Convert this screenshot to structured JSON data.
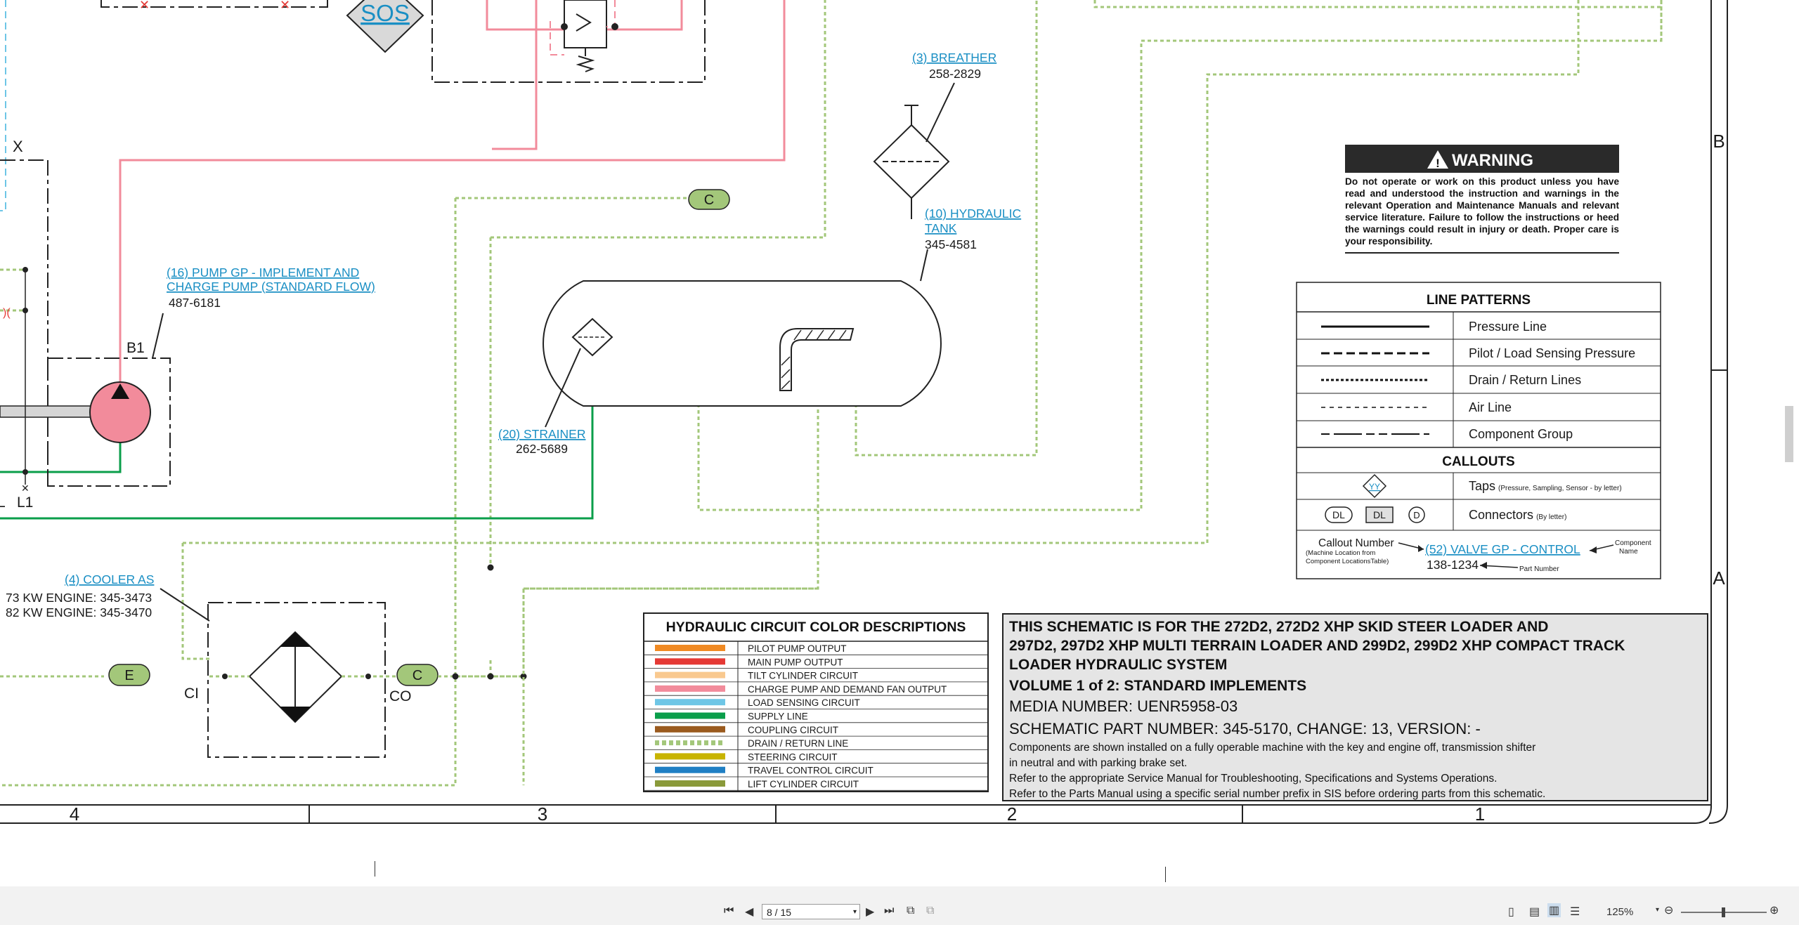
{
  "diagram": {
    "sos_label": "SOS",
    "port_labels": {
      "x": "X",
      "b1": "B1",
      "l1": "L1",
      "l_partial": "L",
      "ci": "CI",
      "co": "CO"
    },
    "connectors": [
      "C",
      "C",
      "E"
    ],
    "callouts": {
      "breather": {
        "name": "(3) BREATHER",
        "part": "258-2829"
      },
      "hydraulic_tank": {
        "name_line1": "(10) HYDRAULIC",
        "name_line2": "TANK",
        "part": "345-4581"
      },
      "pump": {
        "name_line1": "(16) PUMP GP - IMPLEMENT AND",
        "name_line2": "CHARGE PUMP (STANDARD FLOW)",
        "part": "487-6181"
      },
      "strainer": {
        "name": "(20) STRAINER",
        "part": "262-5689"
      },
      "cooler": {
        "name": "(4) COOLER AS",
        "part_line1": "73 KW ENGINE: 345-3473",
        "part_line2": "82 KW ENGINE: 345-3470"
      }
    },
    "grid_rows": [
      "B",
      "A"
    ],
    "grid_columns": [
      "4",
      "3",
      "2",
      "1"
    ]
  },
  "warning": {
    "title": "WARNING",
    "body": "Do not operate or work on this product unless you have read and understood the instruction and warnings in the relevant Operation and Maintenance Manuals and relevant service literature. Failure to follow the instructions or heed the warnings could result in injury or death. Proper care is your responsibility."
  },
  "line_patterns": {
    "title": "LINE PATTERNS",
    "rows": [
      "Pressure Line",
      "Pilot / Load Sensing Pressure",
      "Drain / Return Lines",
      "Air Line",
      "Component Group"
    ],
    "callouts_title": "CALLOUTS",
    "taps_symbol": "YY",
    "taps_label": "Taps",
    "taps_note": "(Pressure, Sampling, Sensor - by letter)",
    "connector_symbols": [
      "DL",
      "DL",
      "D"
    ],
    "connectors_label": "Connectors",
    "connectors_note": "(By letter)",
    "example_callout_number": "Callout Number",
    "example_callout_note1": "(Machine Location from",
    "example_callout_note2": "Component LocationsTable)",
    "example_component": "(52) VALVE GP - CONTROL",
    "example_component_note1": "Component",
    "example_component_note2": "Name",
    "example_part": "138-1234",
    "example_part_note": "Part Number"
  },
  "color_descriptions": {
    "title": "HYDRAULIC CIRCUIT COLOR DESCRIPTIONS",
    "items": [
      {
        "label": "PILOT PUMP OUTPUT",
        "color": "#f08a24"
      },
      {
        "label": "MAIN PUMP OUTPUT",
        "color": "#e53935"
      },
      {
        "label": "TILT CYLINDER CIRCUIT",
        "color": "#f9c98f"
      },
      {
        "label": "CHARGE PUMP AND DEMAND FAN OUTPUT",
        "color": "#f28b9b"
      },
      {
        "label": "LOAD SENSING CIRCUIT",
        "color": "#6ec6e6"
      },
      {
        "label": "SUPPLY LINE",
        "color": "#0a9e4a"
      },
      {
        "label": "COUPLING CIRCUIT",
        "color": "#9a5a1e"
      },
      {
        "label": "DRAIN / RETURN LINE",
        "color": "#a3c77a"
      },
      {
        "label": "STEERING CIRCUIT",
        "color": "#c8b400"
      },
      {
        "label": "TRAVEL CONTROL CIRCUIT",
        "color": "#1f7fc4"
      },
      {
        "label": "LIFT CYLINDER CIRCUIT",
        "color": "#8a9a3a"
      }
    ]
  },
  "schematic_info": {
    "heading_line1": "THIS SCHEMATIC IS FOR THE 272D2, 272D2 XHP SKID STEER LOADER AND",
    "heading_line2": "297D2, 297D2 XHP MULTI TERRAIN LOADER AND 299D2, 299D2 XHP COMPACT TRACK",
    "heading_line3": "LOADER HYDRAULIC SYSTEM",
    "volume": "VOLUME 1 of 2: STANDARD IMPLEMENTS",
    "media_number": "MEDIA NUMBER: UENR5958-03",
    "part_number": "SCHEMATIC PART NUMBER: 345-5170, CHANGE: 13, VERSION: -",
    "note1a": "Components are shown installed on a fully operable machine with the key and engine off, transmission shifter",
    "note1b": "in neutral and with parking brake set.",
    "note2": "Refer to the appropriate Service Manual for Troubleshooting, Specifications and Systems Operations.",
    "note3": "Refer to the Parts Manual using a specific serial number prefix in SIS before ordering parts from this schematic."
  },
  "viewer": {
    "page_value": "8 / 15",
    "zoom": "125%",
    "colors": {
      "pressure": "#f28b9b",
      "supply": "#0a9e4a",
      "drain": "#a3c77a",
      "load_sensing": "#6ec6e6"
    }
  }
}
